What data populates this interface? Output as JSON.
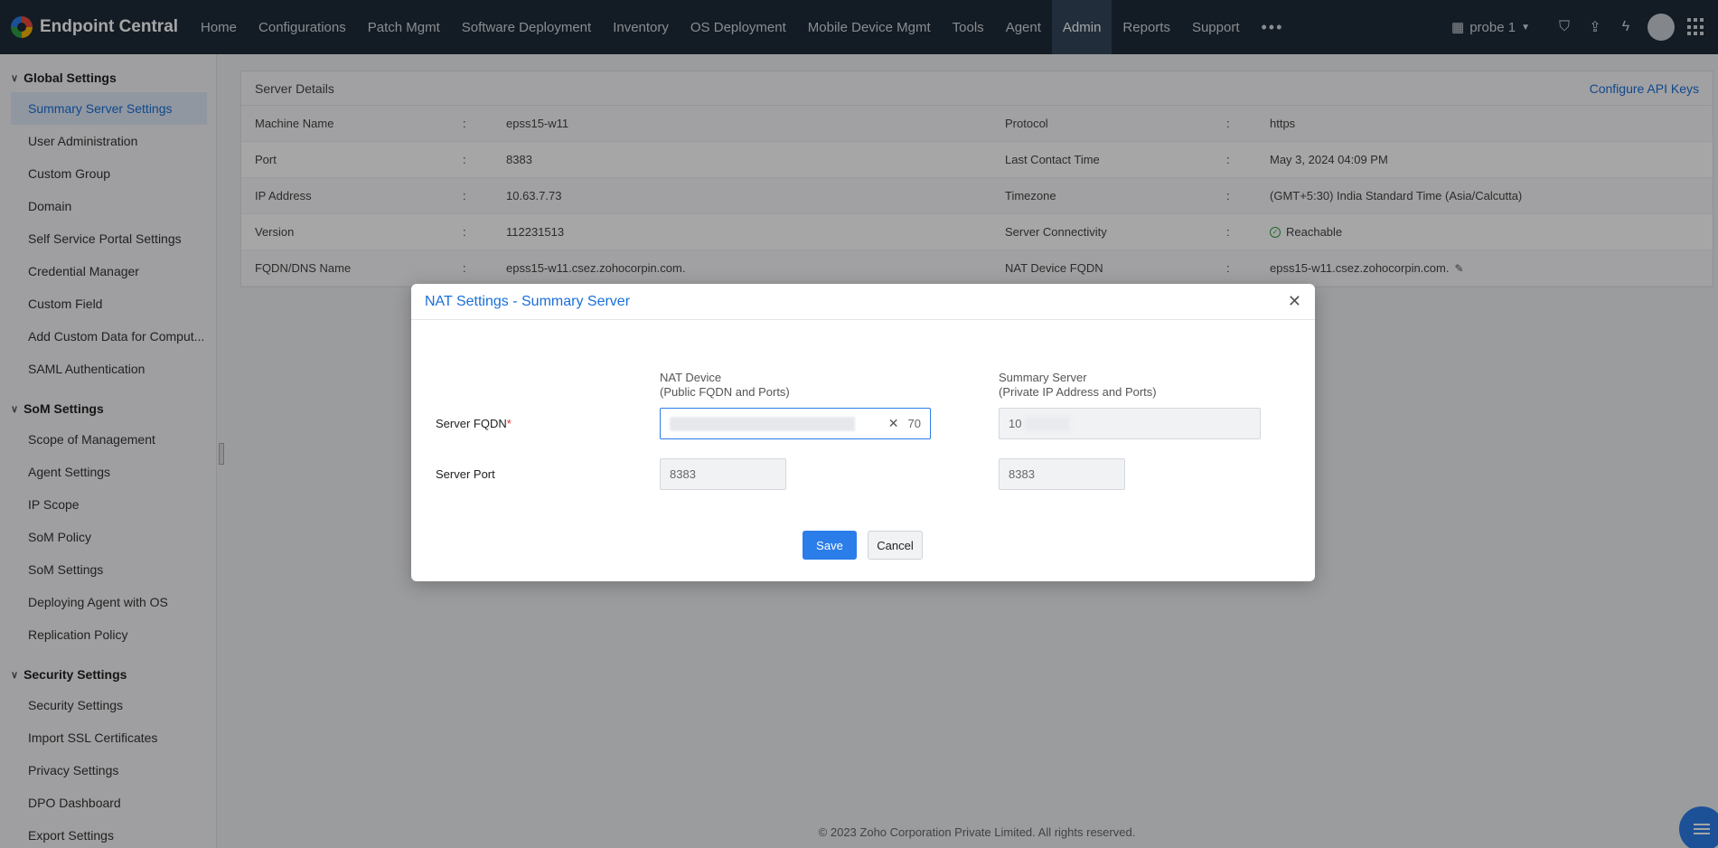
{
  "app": {
    "title": "Endpoint Central"
  },
  "nav": {
    "items": [
      "Home",
      "Configurations",
      "Patch Mgmt",
      "Software Deployment",
      "Inventory",
      "OS Deployment",
      "Mobile Device Mgmt",
      "Tools",
      "Agent",
      "Admin",
      "Reports",
      "Support"
    ],
    "active": "Admin",
    "more": "•••"
  },
  "topright": {
    "probe": "probe 1"
  },
  "sidebar": {
    "sections": [
      {
        "title": "Global Settings",
        "items": [
          "Summary Server Settings",
          "User Administration",
          "Custom Group",
          "Domain",
          "Self Service Portal Settings",
          "Credential Manager",
          "Custom Field",
          "Add Custom Data for Comput...",
          "SAML Authentication"
        ]
      },
      {
        "title": "SoM Settings",
        "items": [
          "Scope of Management",
          "Agent Settings",
          "IP Scope",
          "SoM Policy",
          "SoM Settings",
          "Deploying Agent with OS",
          "Replication Policy"
        ]
      },
      {
        "title": "Security Settings",
        "items": [
          "Security Settings",
          "Import SSL Certificates",
          "Privacy Settings",
          "DPO Dashboard",
          "Export Settings"
        ]
      }
    ],
    "active": "Summary Server Settings"
  },
  "details": {
    "title": "Server Details",
    "config_link": "Configure API Keys",
    "separator": ":",
    "rows": [
      {
        "label": "Machine Name",
        "value": "epss15-w11",
        "label2": "Protocol",
        "value2": "https"
      },
      {
        "label": "Port",
        "value": "8383",
        "label2": "Last Contact Time",
        "value2": "May 3, 2024 04:09 PM"
      },
      {
        "label": "IP Address",
        "value": "10.63.7.73",
        "label2": "Timezone",
        "value2": "(GMT+5:30) India Standard Time (Asia/Calcutta)"
      },
      {
        "label": "Version",
        "value": "112231513",
        "label2": "Server Connectivity",
        "value2": "Reachable"
      },
      {
        "label": "FQDN/DNS Name",
        "value": "epss15-w11.csez.zohocorpin.com.",
        "label2": "NAT Device FQDN",
        "value2": "epss15-w11.csez.zohocorpin.com."
      }
    ]
  },
  "modal": {
    "title": "NAT Settings - Summary Server",
    "col1_title": "NAT Device",
    "col1_sub": "(Public FQDN and Ports)",
    "col2_title": "Summary Server",
    "col2_sub": "(Private IP Address and Ports)",
    "fqdn_label": "Server FQDN",
    "required_mark": "*",
    "fqdn_nat_tail": "70",
    "fqdn_server_prefix": "10",
    "port_label": "Server Port",
    "port_nat": "8383",
    "port_server": "8383",
    "save": "Save",
    "cancel": "Cancel"
  },
  "footer": {
    "text": "© 2023 Zoho Corporation Private Limited.  All rights reserved."
  }
}
